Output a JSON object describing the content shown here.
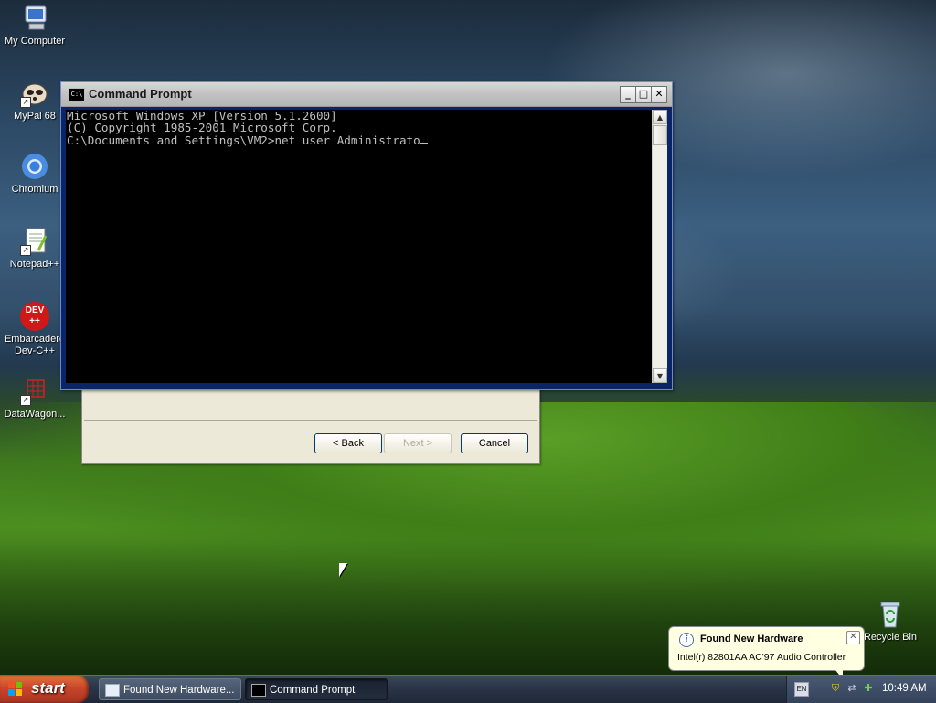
{
  "desktop": {
    "icons": [
      {
        "label": "My Computer",
        "icon": "computer-icon"
      },
      {
        "label": "MyPal 68",
        "icon": "mypal-browser-icon"
      },
      {
        "label": "Chromium",
        "icon": "chromium-icon"
      },
      {
        "label": "Notepad++",
        "icon": "notepadpp-icon"
      },
      {
        "label": "Embarcadero Dev-C++",
        "line1": "Embarcadero",
        "line2": "Dev-C++",
        "icon": "devcpp-icon",
        "badge": "DEV",
        "badge2": "++"
      },
      {
        "label": "DataWagon...",
        "icon": "datawagon-icon"
      },
      {
        "label": "Recycle Bin",
        "icon": "recycle-bin-icon"
      }
    ]
  },
  "wizard": {
    "back_label": "< Back",
    "next_label": "Next >",
    "cancel_label": "Cancel"
  },
  "cmd_window": {
    "title": "Command Prompt",
    "icon_text": "C:\\",
    "minimize": "_",
    "maximize": "□",
    "close": "✕",
    "lines": [
      "Microsoft Windows XP [Version 5.1.2600]",
      "(C) Copyright 1985-2001 Microsoft Corp.",
      "",
      "C:\\Documents and Settings\\VM2>net user Administrato"
    ]
  },
  "balloon": {
    "title": "Found New Hardware",
    "text": "Intel(r) 82801AA AC'97 Audio Controller",
    "info_glyph": "i",
    "close_glyph": "✕"
  },
  "taskbar": {
    "start_label": "start",
    "tasks": [
      {
        "label": "Found New Hardware...",
        "active": false
      },
      {
        "label": "Command Prompt",
        "active": true
      }
    ],
    "tray": {
      "language": "EN",
      "time": "10:49 AM"
    }
  },
  "colors": {
    "console_bg": "#000000",
    "console_fg": "#c0c0c0",
    "start_button": "#c9452a",
    "balloon_bg": "#ffffe1"
  }
}
